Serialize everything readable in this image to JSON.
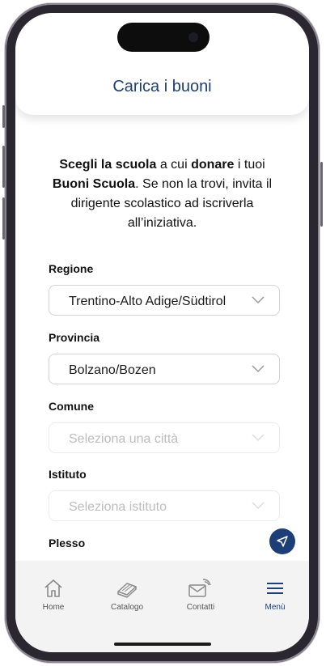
{
  "header": {
    "title": "Carica i buoni"
  },
  "intro": {
    "p1_bold": "Scegli la scuola",
    "p2": " a cui ",
    "p3_bold": "donare",
    "p4": " i tuoi ",
    "p5_bold": "Buoni Scuola",
    "p6": ". Se non la trovi, invita il dirigente scolastico ad iscriverla all’iniziativa."
  },
  "form": {
    "regione": {
      "label": "Regione",
      "value": "Trentino-Alto Adige/Südtirol"
    },
    "provincia": {
      "label": "Provincia",
      "value": "Bolzano/Bozen"
    },
    "comune": {
      "label": "Comune",
      "placeholder": "Seleziona una città"
    },
    "istituto": {
      "label": "Istituto",
      "placeholder": "Seleziona istituto"
    },
    "plesso": {
      "label": "Plesso"
    }
  },
  "fab": {
    "icon": "navigation-arrow-icon"
  },
  "tabbar": {
    "items": [
      {
        "label": "Home",
        "icon": "home-icon"
      },
      {
        "label": "Catalogo",
        "icon": "catalog-book-icon"
      },
      {
        "label": "Contatti",
        "icon": "contact-mail-icon"
      },
      {
        "label": "Menù",
        "icon": "hamburger-menu-icon",
        "active": true
      }
    ]
  },
  "colors": {
    "accent": "#1d3f78",
    "tabbar_bg": "#f3f3f3",
    "border": "#d4d4d4",
    "placeholder": "#bdbdbd"
  }
}
